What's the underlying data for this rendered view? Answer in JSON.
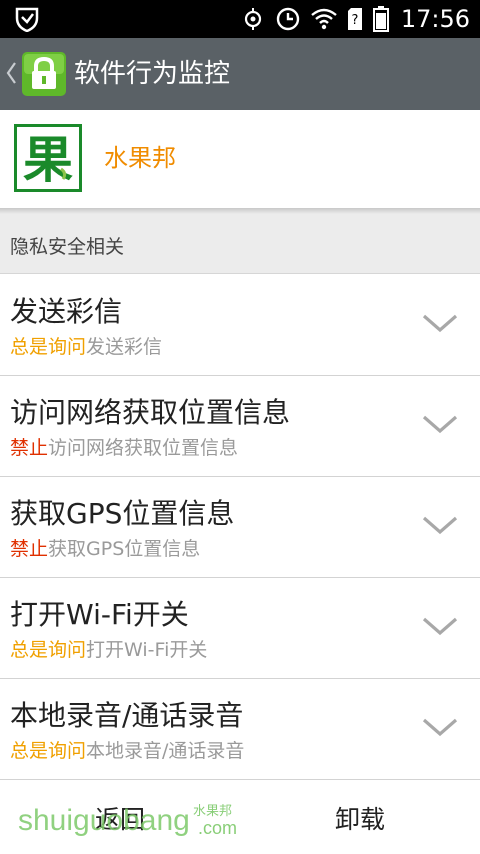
{
  "status_bar": {
    "time": "17:56",
    "icons": [
      "shield-logo-icon",
      "sync-icon",
      "alarm-icon",
      "wifi-icon",
      "sim-unknown-icon",
      "battery-icon"
    ]
  },
  "title_bar": {
    "title": "软件行为监控",
    "icon": "green-lock-icon"
  },
  "app": {
    "name": "水果邦",
    "icon_glyph": "果"
  },
  "section": {
    "label": "隐私安全相关"
  },
  "colors": {
    "ask": "#f0a000",
    "forbid": "#e03000",
    "subtext": "#9a9a9a"
  },
  "permissions": [
    {
      "title": "发送彩信",
      "state": "总是询问",
      "state_type": "ask",
      "desc": "发送彩信"
    },
    {
      "title": "访问网络获取位置信息",
      "state": "禁止",
      "state_type": "forbid",
      "desc": "访问网络获取位置信息"
    },
    {
      "title": "获取GPS位置信息",
      "state": "禁止",
      "state_type": "forbid",
      "desc": "获取GPS位置信息"
    },
    {
      "title": "打开Wi-Fi开关",
      "state": "总是询问",
      "state_type": "ask",
      "desc": "打开Wi-Fi开关"
    },
    {
      "title": "本地录音/通话录音",
      "state": "总是询问",
      "state_type": "ask",
      "desc": "本地录音/通话录音"
    }
  ],
  "bottom_bar": {
    "back_label": "返回",
    "uninstall_label": "卸载"
  },
  "watermark": {
    "text": "shuiguobang",
    "small": "水果邦",
    "suffix": ".com"
  }
}
